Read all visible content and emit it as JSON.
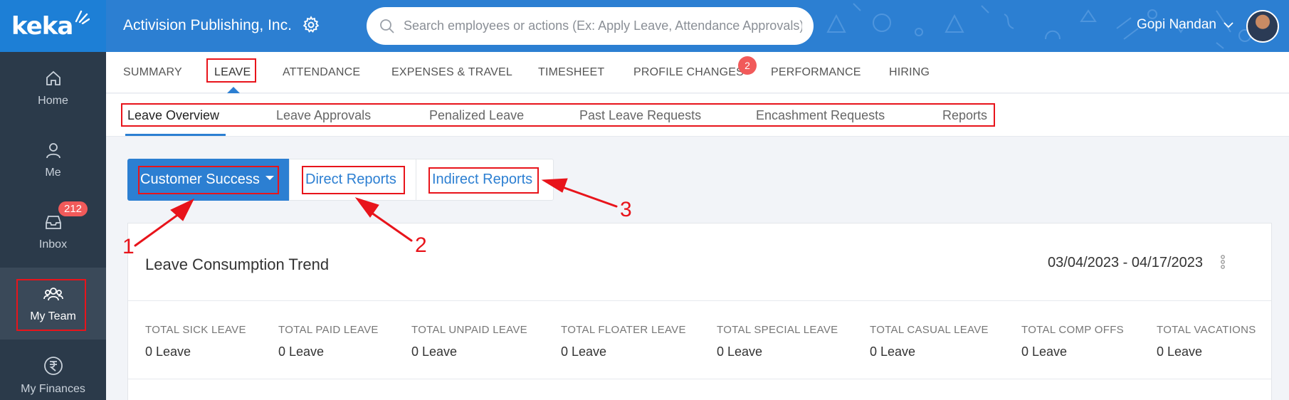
{
  "brand": {
    "logo_text": "keka",
    "accent": "#2c7fd2",
    "sidebar_bg": "#2b3a4a",
    "annotation_red": "#e8141b"
  },
  "sidebar": {
    "items": [
      {
        "label": "Home",
        "icon": "home-icon"
      },
      {
        "label": "Me",
        "icon": "user-icon"
      },
      {
        "label": "Inbox",
        "icon": "inbox-icon",
        "badge": "212"
      },
      {
        "label": "My Team",
        "icon": "team-icon",
        "active": true
      },
      {
        "label": "My Finances",
        "icon": "rupee-icon"
      }
    ]
  },
  "header": {
    "company": "Activision Publishing, Inc.",
    "search_placeholder": "Search employees or actions (Ex: Apply Leave, Attendance Approvals)",
    "user_name": "Gopi Nandan"
  },
  "main_tabs": [
    {
      "label": "SUMMARY"
    },
    {
      "label": "LEAVE",
      "active": true
    },
    {
      "label": "ATTENDANCE"
    },
    {
      "label": "EXPENSES & TRAVEL"
    },
    {
      "label": "TIMESHEET"
    },
    {
      "label": "PROFILE CHANGES",
      "badge": "2"
    },
    {
      "label": "PERFORMANCE"
    },
    {
      "label": "HIRING"
    }
  ],
  "sub_tabs": [
    {
      "label": "Leave Overview",
      "active": true
    },
    {
      "label": "Leave Approvals"
    },
    {
      "label": "Penalized Leave"
    },
    {
      "label": "Past Leave Requests"
    },
    {
      "label": "Encashment Requests"
    },
    {
      "label": "Reports"
    }
  ],
  "filter": {
    "department": "Customer Success",
    "direct": "Direct Reports",
    "indirect": "Indirect Reports"
  },
  "annotations": {
    "n1": "1",
    "n2": "2",
    "n3": "3"
  },
  "card": {
    "title": "Leave Consumption Trend",
    "date_range": "03/04/2023 - 04/17/2023",
    "stats": [
      {
        "label": "TOTAL SICK LEAVE",
        "value": "0 Leave"
      },
      {
        "label": "TOTAL PAID LEAVE",
        "value": "0 Leave"
      },
      {
        "label": "TOTAL UNPAID LEAVE",
        "value": "0 Leave"
      },
      {
        "label": "TOTAL FLOATER LEAVE",
        "value": "0 Leave"
      },
      {
        "label": "TOTAL SPECIAL LEAVE",
        "value": "0 Leave"
      },
      {
        "label": "TOTAL CASUAL LEAVE",
        "value": "0 Leave"
      },
      {
        "label": "TOTAL COMP OFFS",
        "value": "0 Leave"
      },
      {
        "label": "TOTAL VACATIONS",
        "value": "0 Leave"
      }
    ]
  }
}
